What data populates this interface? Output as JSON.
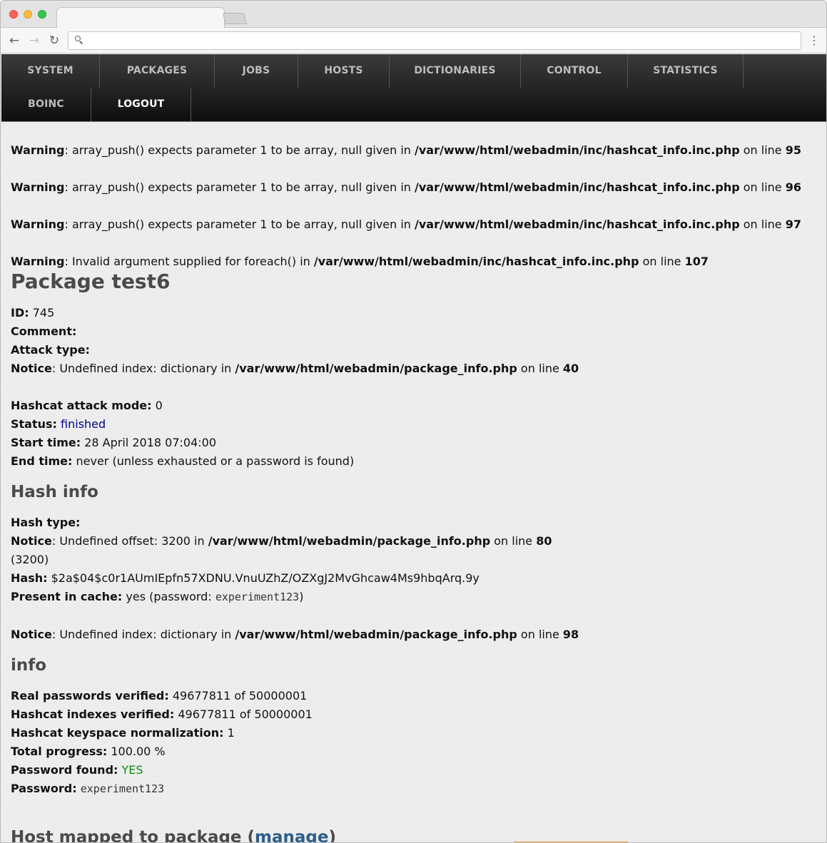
{
  "browser": {
    "address": ""
  },
  "menu": {
    "row1": [
      "SYSTEM",
      "PACKAGES",
      "JOBS",
      "HOSTS",
      "DICTIONARIES",
      "CONTROL",
      "STATISTICS"
    ],
    "row2": [
      "BOINC",
      "LOGOUT"
    ]
  },
  "warnings": [
    {
      "label": "Warning",
      "msg": ": array_push() expects parameter 1 to be array, null given in ",
      "file": "/var/www/html/webadmin/inc/hashcat_info.inc.php",
      "on": " on line ",
      "line": "95"
    },
    {
      "label": "Warning",
      "msg": ": array_push() expects parameter 1 to be array, null given in ",
      "file": "/var/www/html/webadmin/inc/hashcat_info.inc.php",
      "on": " on line ",
      "line": "96"
    },
    {
      "label": "Warning",
      "msg": ": array_push() expects parameter 1 to be array, null given in ",
      "file": "/var/www/html/webadmin/inc/hashcat_info.inc.php",
      "on": " on line ",
      "line": "97"
    },
    {
      "label": "Warning",
      "msg": ": Invalid argument supplied for foreach() in ",
      "file": "/var/www/html/webadmin/inc/hashcat_info.inc.php",
      "on": " on line ",
      "line": "107"
    }
  ],
  "package": {
    "title": "Package test6",
    "id_label": "ID:",
    "id_value": " 745",
    "comment_label": "Comment:",
    "attack_label": "Attack type:",
    "notice1": {
      "label": "Notice",
      "msg": ": Undefined index: dictionary in ",
      "file": "/var/www/html/webadmin/package_info.php",
      "on": " on line ",
      "line": "40"
    },
    "mode_label": "Hashcat attack mode:",
    "mode_value": " 0",
    "status_label": "Status:",
    "status_value": "finished",
    "start_label": "Start time:",
    "start_value": " 28 April 2018 07:04:00",
    "end_label": "End time:",
    "end_value": " never (unless exhausted or a password is found)"
  },
  "hash_info": {
    "heading": "Hash info",
    "type_label": "Hash type:",
    "notice2": {
      "label": "Notice",
      "msg": ": Undefined offset: 3200 in ",
      "file": "/var/www/html/webadmin/package_info.php",
      "on": " on line ",
      "line": "80"
    },
    "type_value": "(3200)",
    "hash_label": "Hash:",
    "hash_value": " $2a$04$c0r1AUmIEpfn57XDNU.VnuUZhZ/OZXgJ2MvGhcaw4Ms9hbqArq.9y",
    "cache_label": "Present in cache:",
    "cache_pre": " yes (password: ",
    "cache_pw": "experiment123",
    "cache_post": ")",
    "notice3": {
      "label": "Notice",
      "msg": ": Undefined index: dictionary in ",
      "file": "/var/www/html/webadmin/package_info.php",
      "on": " on line ",
      "line": "98"
    }
  },
  "info": {
    "heading": "info",
    "real_label": "Real passwords verified:",
    "real_value": " 49677811 of 50000001",
    "idx_label": "Hashcat indexes verified:",
    "idx_value": " 49677811 of 50000001",
    "norm_label": "Hashcat keyspace normalization:",
    "norm_value": " 1",
    "progress_label": "Total progress:",
    "progress_value": " 100.00 %",
    "found_label": "Password found:",
    "found_value": "YES",
    "pw_label": "Password:",
    "pw_value": "experiment123"
  },
  "hosts": {
    "heading_pre": "Host mapped to package (",
    "heading_link": "manage",
    "heading_post": ")"
  },
  "colors": {
    "status_finished": "#00008b",
    "password_found": "#108a10",
    "menubar": "#1a1a1a"
  }
}
